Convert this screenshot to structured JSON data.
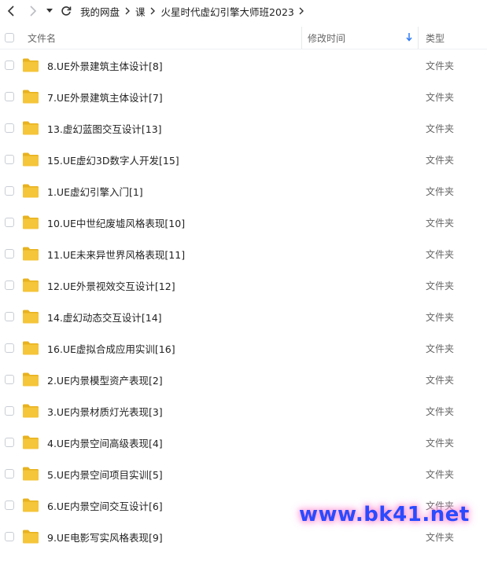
{
  "nav": {
    "back_icon": "chevron-left-icon",
    "forward_icon": "chevron-right-icon",
    "dropdown_icon": "caret-down-icon",
    "refresh_icon": "refresh-icon"
  },
  "breadcrumb": [
    "我的网盘",
    "课",
    "火星时代虚幻引擎大师班2023"
  ],
  "header": {
    "name": "文件名",
    "mtime": "修改时间",
    "type": "类型"
  },
  "files": [
    {
      "name": "8.UE外景建筑主体设计[8]",
      "type": "文件夹"
    },
    {
      "name": "7.UE外景建筑主体设计[7]",
      "type": "文件夹"
    },
    {
      "name": "13.虚幻蓝图交互设计[13]",
      "type": "文件夹"
    },
    {
      "name": "15.UE虚幻3D数字人开发[15]",
      "type": "文件夹"
    },
    {
      "name": "1.UE虚幻引擎入门[1]",
      "type": "文件夹"
    },
    {
      "name": "10.UE中世纪废墟风格表现[10]",
      "type": "文件夹"
    },
    {
      "name": "11.UE未来异世界风格表现[11]",
      "type": "文件夹"
    },
    {
      "name": "12.UE外景视效交互设计[12]",
      "type": "文件夹"
    },
    {
      "name": "14.虚幻动态交互设计[14]",
      "type": "文件夹"
    },
    {
      "name": "16.UE虚拟合成应用实训[16]",
      "type": "文件夹"
    },
    {
      "name": "2.UE内景模型资产表现[2]",
      "type": "文件夹"
    },
    {
      "name": "3.UE内景材质灯光表现[3]",
      "type": "文件夹"
    },
    {
      "name": "4.UE内景空间高级表现[4]",
      "type": "文件夹"
    },
    {
      "name": "5.UE内景空间项目实训[5]",
      "type": "文件夹"
    },
    {
      "name": "6.UE内景空间交互设计[6]",
      "type": "文件夹"
    },
    {
      "name": "9.UE电影写实风格表现[9]",
      "type": "文件夹"
    }
  ],
  "watermark": "www.bk41.net",
  "colors": {
    "folder": "#F5C53A",
    "sort_arrow": "#2f7bf5",
    "watermark": "#2a4bff"
  }
}
